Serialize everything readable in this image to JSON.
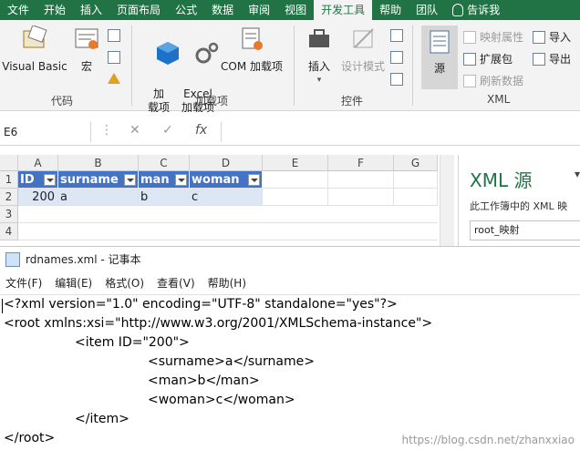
{
  "ribbon": {
    "tabs": [
      "文件",
      "开始",
      "插入",
      "页面布局",
      "公式",
      "数据",
      "审阅",
      "视图",
      "开发工具",
      "帮助",
      "团队",
      "告诉我"
    ],
    "active_tab": "开发工具",
    "groups": {
      "code": {
        "label": "代码",
        "visual_basic": "Visual Basic",
        "macro": "宏"
      },
      "addins": {
        "label": "加载项",
        "add": "加\n载项",
        "excel_addins": "Excel\n加载项",
        "com_addins": "COM 加载项"
      },
      "controls": {
        "label": "控件",
        "insert": "插入",
        "design_mode": "设计模式"
      },
      "xml": {
        "label": "XML",
        "source": "源",
        "map_props": "映射属性",
        "expansion": "扩展包",
        "refresh": "刷新数据",
        "import": "导入",
        "export": "导出"
      }
    }
  },
  "formula_bar": {
    "name_box": "E6",
    "cancel_symbol": "✕",
    "enter_symbol": "✓",
    "fx_symbol": "fx",
    "value": ""
  },
  "sheet": {
    "columns": [
      "A",
      "B",
      "C",
      "D",
      "E",
      "F",
      "G"
    ],
    "rows": [
      "1",
      "2",
      "3",
      "4"
    ],
    "headers": [
      "ID",
      "surname",
      "man",
      "woman"
    ],
    "record": [
      "200",
      "a",
      "b",
      "c"
    ]
  },
  "xml_pane": {
    "title": "XML 源",
    "desc": "此工作簿中的 XML 映",
    "map": "root_映射"
  },
  "notepad": {
    "title": "rdnames.xml - 记事本",
    "menu": [
      "文件(F)",
      "编辑(E)",
      "格式(O)",
      "查看(V)",
      "帮助(H)"
    ],
    "lines": [
      "<?xml version=\"1.0\" encoding=\"UTF-8\" standalone=\"yes\"?>",
      "<root xmlns:xsi=\"http://www.w3.org/2001/XMLSchema-instance\">",
      "<item ID=\"200\">",
      "<surname>a</surname>",
      "<man>b</man>",
      "<woman>c</woman>",
      "</item>",
      "</root>"
    ],
    "watermark": "https://blog.csdn.net/zhanxxiao"
  },
  "colors": {
    "accent": "#217346",
    "table_header": "#4472c4",
    "table_row": "#dce6f5"
  }
}
